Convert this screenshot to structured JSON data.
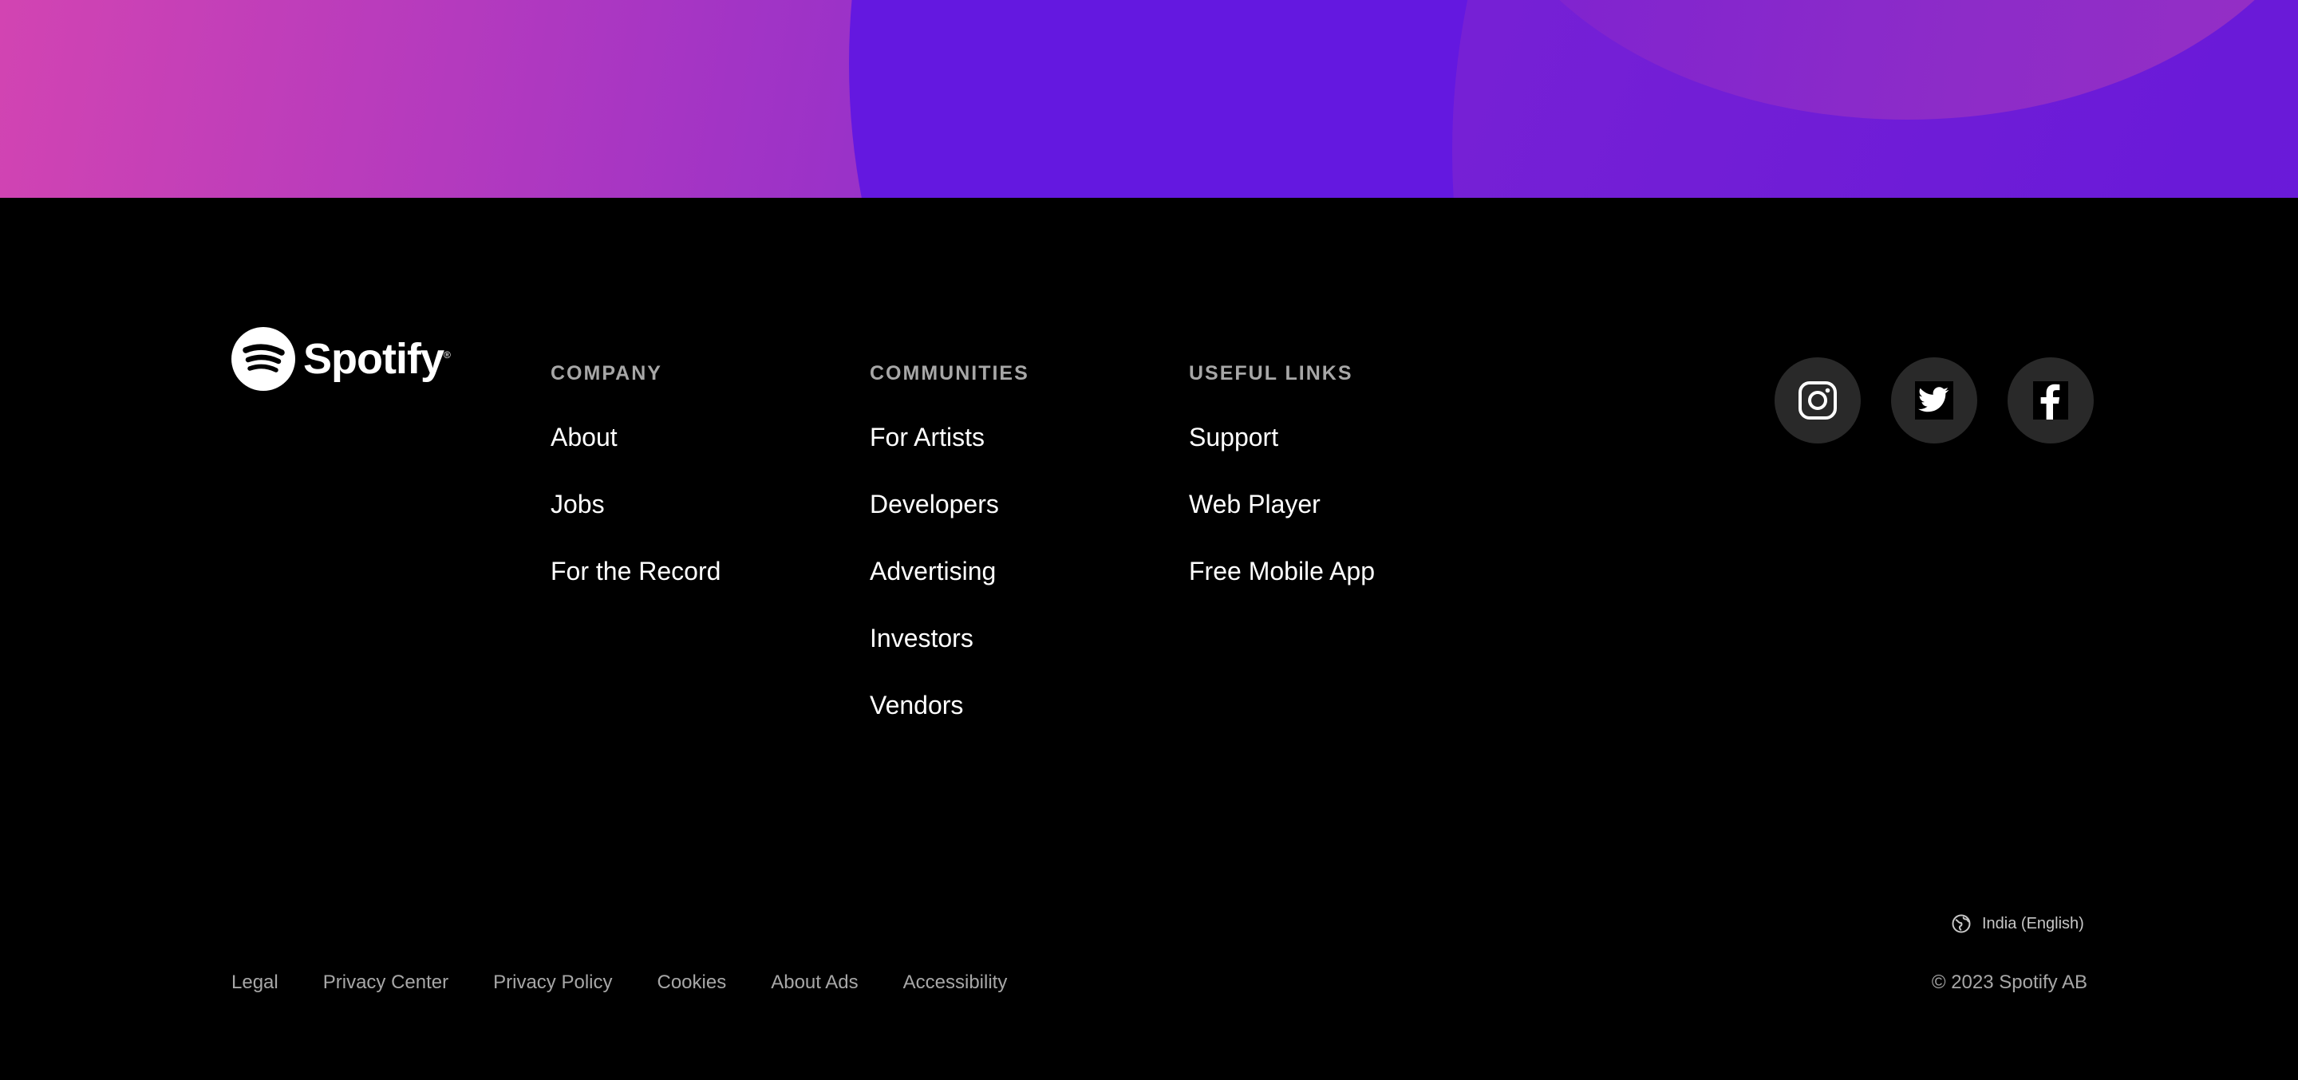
{
  "brand": {
    "name": "Spotify",
    "registered": "®"
  },
  "columns": [
    {
      "title": "COMPANY",
      "links": [
        "About",
        "Jobs",
        "For the Record"
      ]
    },
    {
      "title": "COMMUNITIES",
      "links": [
        "For Artists",
        "Developers",
        "Advertising",
        "Investors",
        "Vendors"
      ]
    },
    {
      "title": "USEFUL LINKS",
      "links": [
        "Support",
        "Web Player",
        "Free Mobile App"
      ]
    }
  ],
  "social": [
    {
      "icon": "instagram-icon"
    },
    {
      "icon": "twitter-icon"
    },
    {
      "icon": "facebook-icon"
    }
  ],
  "locale": {
    "label": "India (English)",
    "icon": "globe-icon"
  },
  "legal": {
    "links": [
      "Legal",
      "Privacy Center",
      "Privacy Policy",
      "Cookies",
      "About Ads",
      "Accessibility"
    ]
  },
  "copyright": "© 2023 Spotify AB",
  "colors": {
    "background": "#000000",
    "hero_pink": "#d244b2",
    "hero_purple": "#6418e0",
    "muted_text": "#a7a7a7",
    "social_button_bg": "#292929"
  }
}
